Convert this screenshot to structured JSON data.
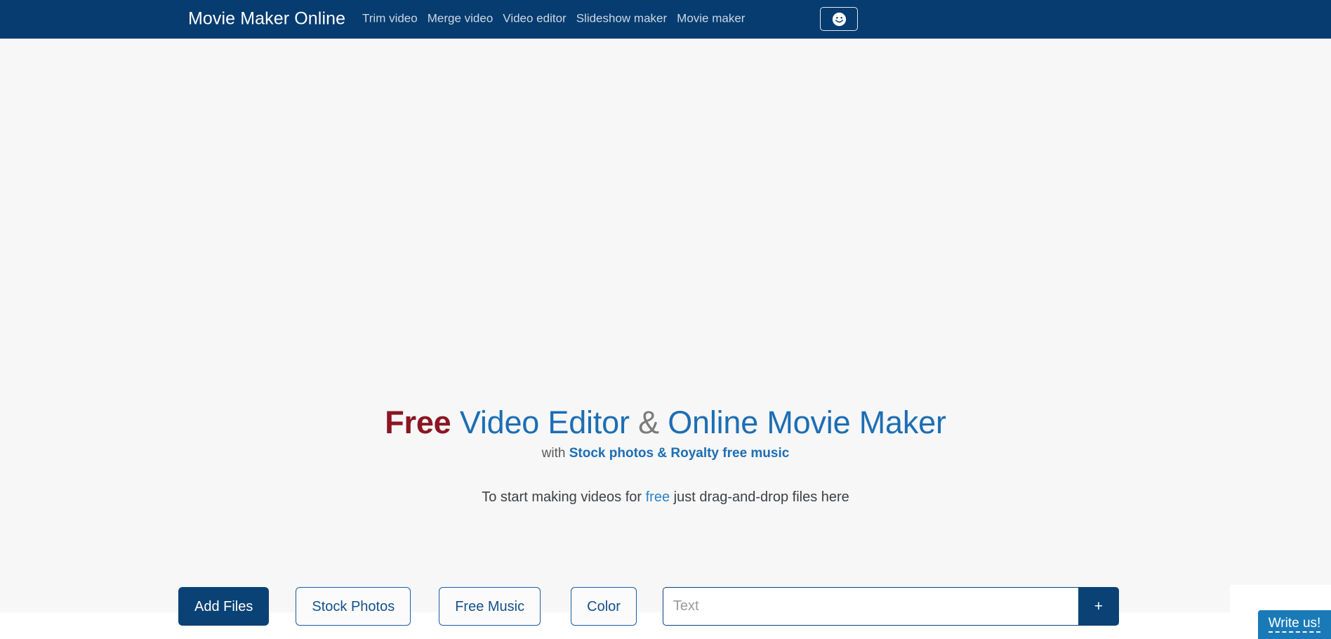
{
  "navbar": {
    "brand": "Movie Maker Online",
    "links": [
      {
        "label": "Trim video"
      },
      {
        "label": "Merge video"
      },
      {
        "label": "Video editor"
      },
      {
        "label": "Slideshow maker"
      },
      {
        "label": "Movie maker"
      }
    ],
    "smiley_button_icon": "smiley-face-icon",
    "background_color": "#063c70",
    "brand_color": "#ffffff",
    "link_color": "#cdd8e4"
  },
  "hero": {
    "headline": {
      "part_free": "Free",
      "part_video_editor": "Video Editor",
      "part_amp": "&",
      "part_online_movie_maker": "Online Movie Maker",
      "free_color": "#8b1622",
      "blue_color": "#1c6eb4",
      "amp_color": "#7b7b7b"
    },
    "subtitle": {
      "prefix": "with",
      "link": "Stock photos & Royalty free music",
      "prefix_color": "#5a5a5a",
      "link_color": "#1c6eb4"
    },
    "dropline": {
      "before": "To start making videos for",
      "link": "free",
      "after": "just drag-and-drop files here",
      "text_color": "#3d4043",
      "link_color": "#2d82c8"
    }
  },
  "actions": {
    "add_files": "Add Files",
    "stock_photos": "Stock Photos",
    "free_music": "Free Music",
    "color": "Color",
    "text_placeholder": "Text",
    "text_value": "",
    "add_text_button": "+",
    "primary_color": "#0a4275",
    "outline_border_color": "#1a5e9e",
    "outline_text_color": "#14508c"
  },
  "chat_widget": {
    "write_us_label": "Write us!",
    "color": "#1a7ab8"
  },
  "page": {
    "content_background": "#f7f7f8",
    "outer_background": "#ffffff"
  }
}
